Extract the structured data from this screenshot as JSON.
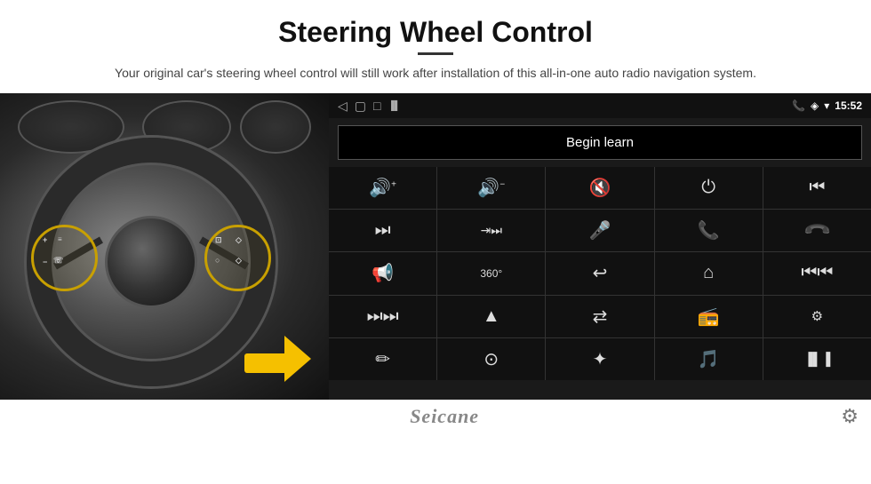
{
  "header": {
    "title": "Steering Wheel Control",
    "subtitle": "Your original car's steering wheel control will still work after installation of this all-in-one auto radio navigation system."
  },
  "status_bar": {
    "time": "15:52",
    "back_icon": "◁",
    "home_icon": "▢",
    "recents_icon": "□",
    "phone_icon": "📞",
    "location_icon": "◈",
    "wifi_icon": "▾"
  },
  "begin_learn_btn": "Begin learn",
  "controls": [
    {
      "icon": "🔊+",
      "label": "volume-up"
    },
    {
      "icon": "🔊−",
      "label": "volume-down"
    },
    {
      "icon": "🔇",
      "label": "mute"
    },
    {
      "icon": "⏻",
      "label": "power"
    },
    {
      "icon": "⏮",
      "label": "prev-track"
    },
    {
      "icon": "⏭",
      "label": "next-track"
    },
    {
      "icon": "⇥⏭",
      "label": "forward"
    },
    {
      "icon": "🎤",
      "label": "mic"
    },
    {
      "icon": "📞",
      "label": "phone"
    },
    {
      "icon": "↩",
      "label": "hang-up"
    },
    {
      "icon": "🔔",
      "label": "horn"
    },
    {
      "icon": "⟳",
      "label": "360-view"
    },
    {
      "icon": "↩",
      "label": "back"
    },
    {
      "icon": "⌂",
      "label": "home"
    },
    {
      "icon": "⏮⏮",
      "label": "rewind"
    },
    {
      "icon": "⏭⏭",
      "label": "fast-forward"
    },
    {
      "icon": "▲",
      "label": "navigate"
    },
    {
      "icon": "⇄",
      "label": "swap"
    },
    {
      "icon": "📻",
      "label": "radio"
    },
    {
      "icon": "⚙",
      "label": "equalizer"
    },
    {
      "icon": "✏",
      "label": "edit"
    },
    {
      "icon": "⊙",
      "label": "circle-btn"
    },
    {
      "icon": "✦",
      "label": "bluetooth"
    },
    {
      "icon": "🎵",
      "label": "music"
    },
    {
      "icon": "▐▌▐",
      "label": "spectrum"
    }
  ],
  "bottom": {
    "logo": "Seicane",
    "gear_label": "settings"
  }
}
